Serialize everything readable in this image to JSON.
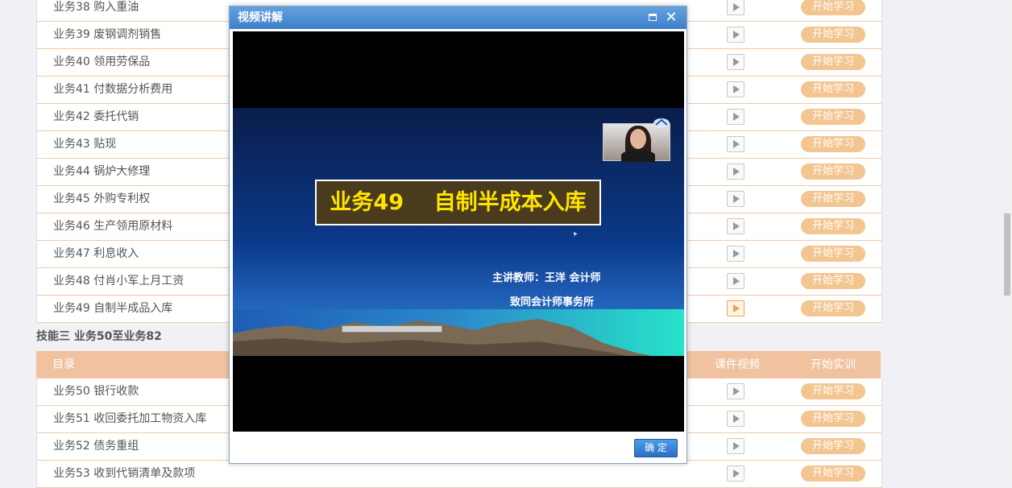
{
  "list_top": {
    "rows": [
      {
        "label": "业务38 购入重油",
        "action": "开始学习"
      },
      {
        "label": "业务39 废钢调剂销售",
        "action": "开始学习"
      },
      {
        "label": "业务40 领用劳保品",
        "action": "开始学习"
      },
      {
        "label": "业务41 付数据分析费用",
        "action": "开始学习"
      },
      {
        "label": "业务42 委托代销",
        "action": "开始学习"
      },
      {
        "label": "业务43 贴现",
        "action": "开始学习"
      },
      {
        "label": "业务44 锅炉大修理",
        "action": "开始学习"
      },
      {
        "label": "业务45 外购专利权",
        "action": "开始学习"
      },
      {
        "label": "业务46 生产领用原材料",
        "action": "开始学习"
      },
      {
        "label": "业务47 利息收入",
        "action": "开始学习"
      },
      {
        "label": "业务48 付肖小军上月工资",
        "action": "开始学习"
      },
      {
        "label": "业务49 自制半成品入库",
        "action": "开始学习"
      }
    ]
  },
  "section": {
    "title": "技能三 业务50至业务82"
  },
  "header": {
    "col_catalog": "目录",
    "col_video": "课件视频",
    "col_practice": "开始实训"
  },
  "list_bottom": {
    "rows": [
      {
        "label": "业务50 银行收款",
        "action": "开始学习"
      },
      {
        "label": "业务51 收回委托加工物资入库",
        "action": "开始学习"
      },
      {
        "label": "业务52 债务重组",
        "action": "开始学习"
      },
      {
        "label": "业务53 收到代销清单及款项",
        "action": "开始学习"
      }
    ]
  },
  "modal": {
    "title": "视频讲解",
    "slide_title": "业务49    自制半成本入库",
    "teacher": "主讲教师：王洋  会计师",
    "firm": "致同会计师事务所",
    "ok_label": "确 定"
  },
  "colors": {
    "accent": "#f1c29f",
    "button": "#f3c590",
    "modal_title": "#4b8fd6"
  }
}
